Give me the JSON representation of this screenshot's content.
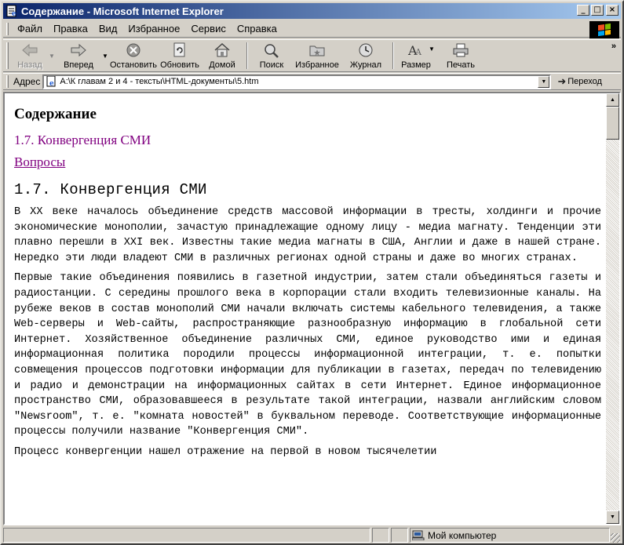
{
  "window": {
    "title": "Содержание - Microsoft Internet Explorer",
    "buttons": {
      "minimize": "_",
      "maximize": "□",
      "close": "×"
    }
  },
  "menu": {
    "items": [
      "Файл",
      "Правка",
      "Вид",
      "Избранное",
      "Сервис",
      "Справка"
    ]
  },
  "toolbar": {
    "back": "Назад",
    "forward": "Вперед",
    "stop": "Остановить",
    "refresh": "Обновить",
    "home": "Домой",
    "search": "Поиск",
    "favorites": "Избранное",
    "history": "Журнал",
    "size": "Размер",
    "print": "Печать",
    "more": "»"
  },
  "address": {
    "label": "Адрес",
    "value": "A:\\К главам 2 и 4 - тексты\\HTML-документы\\5.htm",
    "go": "Переход"
  },
  "page": {
    "heading": "Содержание",
    "link_section": "1.7. Конвергенция СМИ",
    "link_questions": "Вопросы",
    "section_title": "1.7. Конвергенция СМИ",
    "paragraphs": [
      "В XX веке началось объединение средств массовой информации в тресты, холдинги и прочие экономические монополии, зачастую принадлежащие одному лицу - медиа магнату. Тенденции эти плавно перешли в XXI век. Известны такие медиа магнаты в США, Англии и даже в нашей стране. Нередко эти люди владеют СМИ в различных регионах одной страны и даже во многих странах.",
      "Первые такие объединения появились в газетной индустрии, затем стали объединяться газеты и радиостанции. С середины прошлого века в корпорации стали входить телевизионные каналы. На рубеже веков в состав монополий СМИ начали включать системы кабельного телевидения, а также Web-серверы и Web-сайты, распространяющие разнообразную информацию в глобальной сети Интернет. Хозяйственное объединение различных СМИ, единое руководство ими и единая информационная политика породили процессы информационной интеграции, т. е. попытки совмещения процессов подготовки информации для публикации в газетах, передач по телевидению и радио и демонстрации на информационных сайтах в сети Интернет. Единое информационное пространство СМИ, образовавшееся в результате такой интеграции, назвали английским словом \"Newsroom\", т. е. \"комната новостей\" в буквальном переводе. Соответствующие информационные процессы получили название \"Конвергенция СМИ\".",
      "Процесс конвергенции нашел отражение на первой в новом тысячелетии"
    ]
  },
  "status": {
    "main": "",
    "zone": "Мой компьютер"
  }
}
